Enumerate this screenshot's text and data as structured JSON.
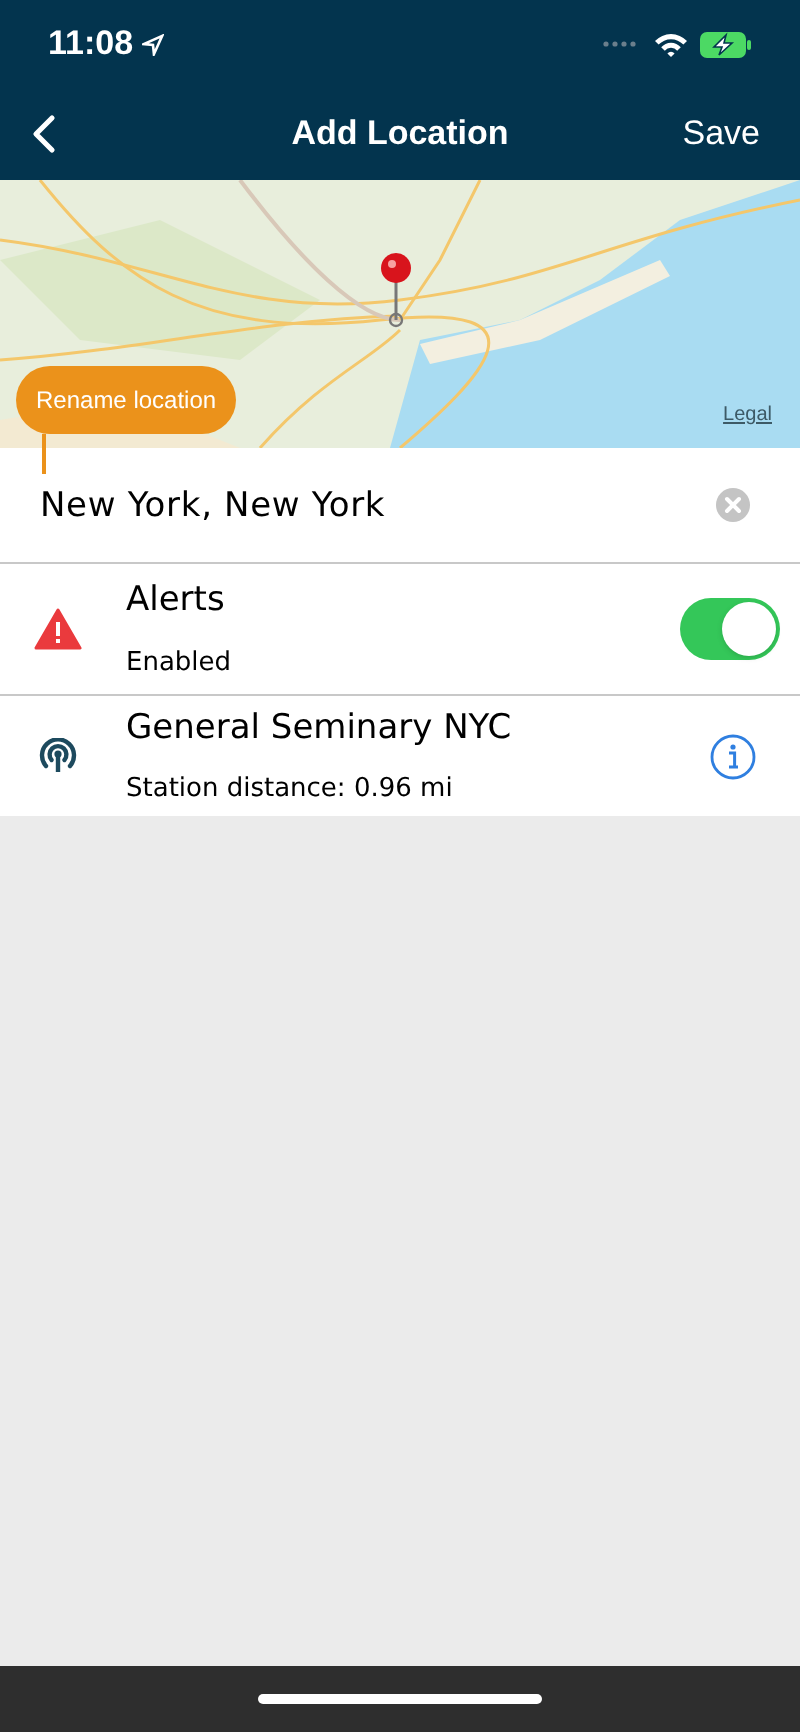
{
  "status_bar": {
    "time": "11:08"
  },
  "nav": {
    "title": "Add Location",
    "save": "Save"
  },
  "map": {
    "legal": "Legal",
    "tooltip": "Rename location"
  },
  "location_field": {
    "value": "New York, New York"
  },
  "alerts": {
    "title": "Alerts",
    "status": "Enabled",
    "on": true
  },
  "station": {
    "name": "General Seminary NYC",
    "distance": "Station distance: 0.96 mi"
  }
}
